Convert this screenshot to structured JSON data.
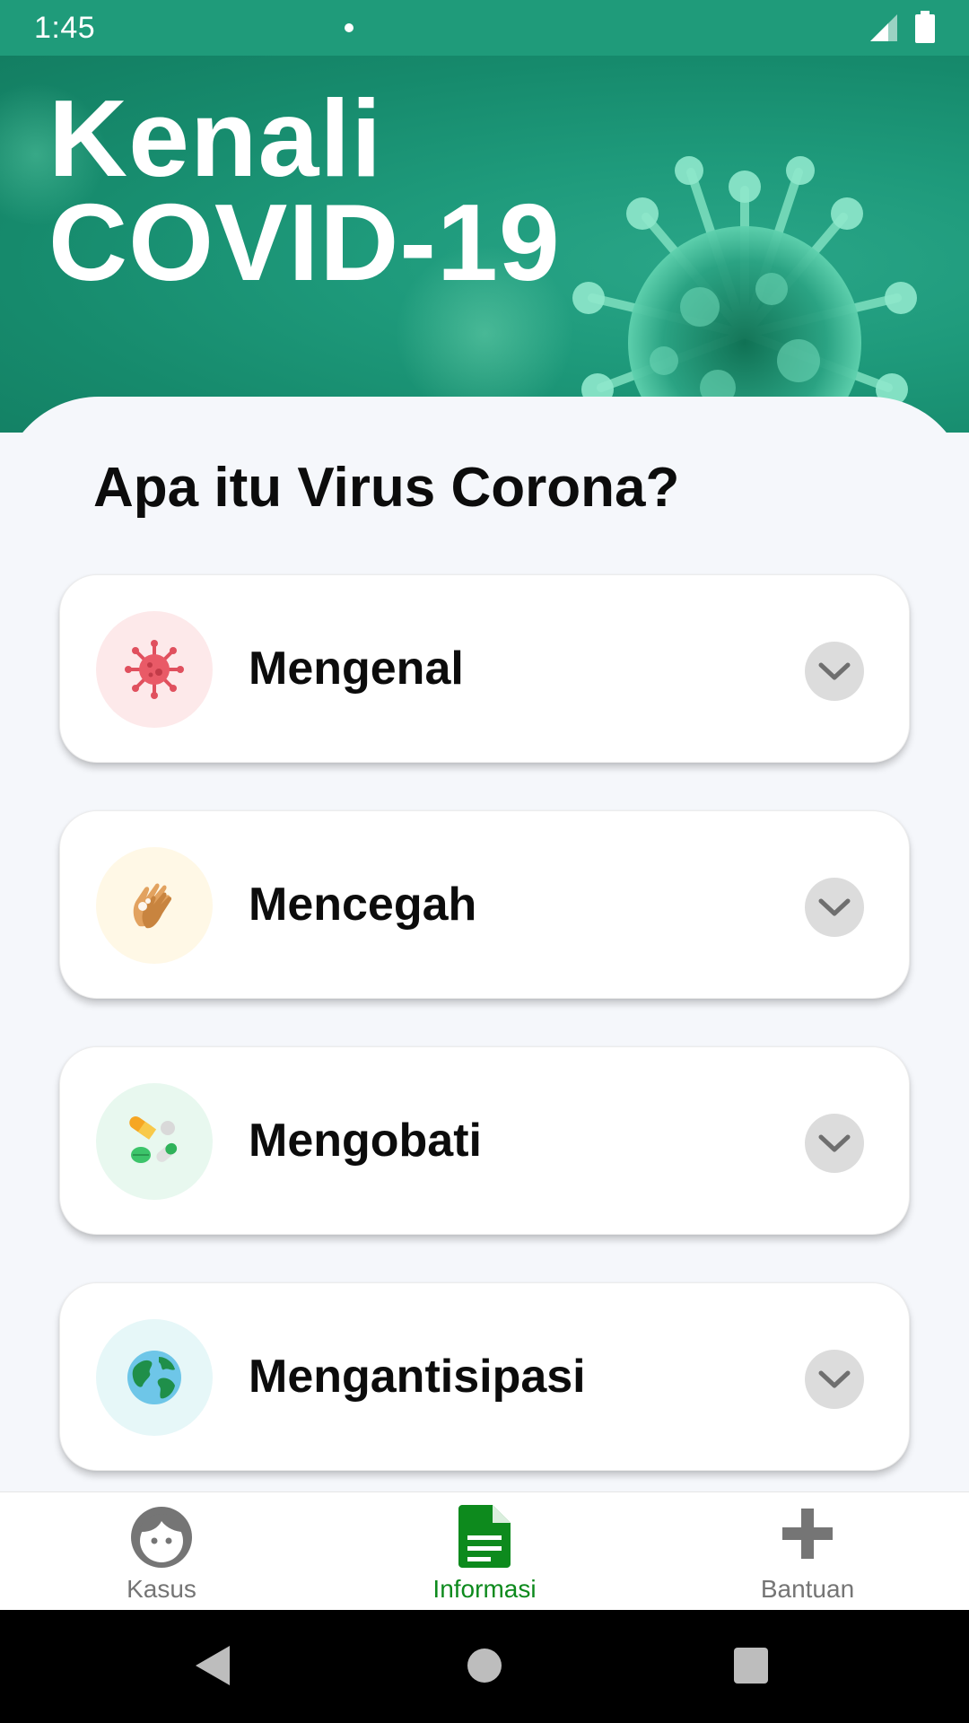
{
  "status_bar": {
    "time": "1:45"
  },
  "hero": {
    "title_line1": "Kenali",
    "title_line2": "COVID-19"
  },
  "section": {
    "title": "Apa itu Virus Corona?"
  },
  "cards": [
    {
      "label": "Mengenal",
      "icon": "virus-icon",
      "icon_bg": "#fde9ea"
    },
    {
      "label": "Mencegah",
      "icon": "hand-wash-icon",
      "icon_bg": "#fff8e6"
    },
    {
      "label": "Mengobati",
      "icon": "pills-icon",
      "icon_bg": "#e8f8ef"
    },
    {
      "label": "Mengantisipasi",
      "icon": "globe-icon",
      "icon_bg": "#e6f7f8"
    }
  ],
  "bottom_nav": {
    "items": [
      {
        "label": "Kasus",
        "icon": "face-icon",
        "active": false
      },
      {
        "label": "Informasi",
        "icon": "document-icon",
        "active": true
      },
      {
        "label": "Bantuan",
        "icon": "plus-icon",
        "active": false
      }
    ]
  },
  "colors": {
    "primary": "#1f9b7a",
    "active_nav": "#0d8a1d",
    "inactive_nav": "#757575"
  }
}
